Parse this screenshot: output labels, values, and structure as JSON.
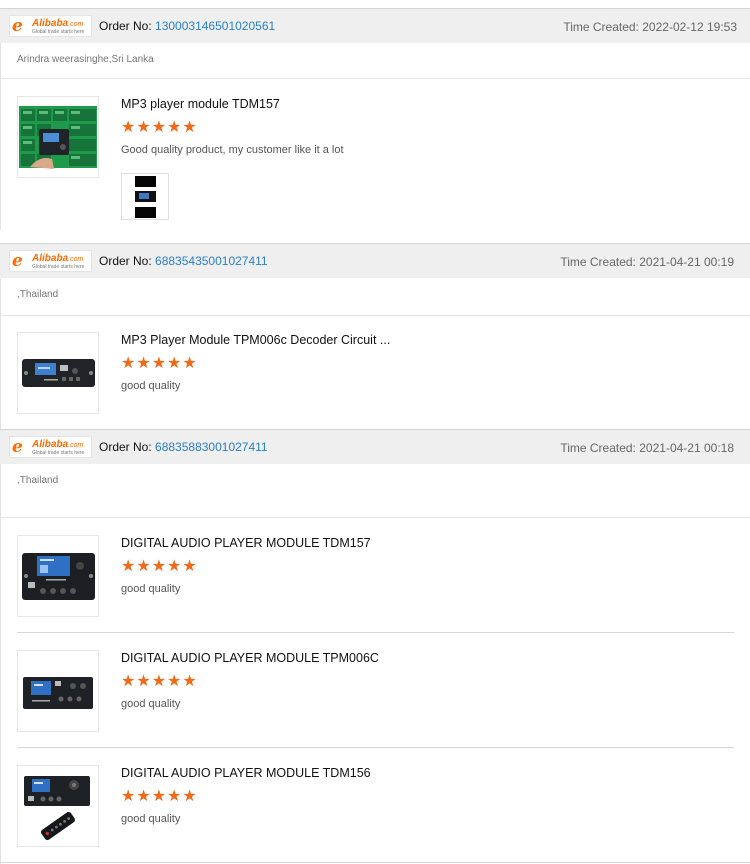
{
  "brand": {
    "logo_text": "Alibaba",
    "logo_suffix": ".com",
    "logo_tagline": "Global trade starts here"
  },
  "labels": {
    "order_no": "Order No:",
    "time_created": "Time Created:"
  },
  "colors": {
    "star": "#f06a1a",
    "order_number": "#2a7fc7",
    "header_bg": "#efefef",
    "brand": "#ff6a00"
  },
  "orders": [
    {
      "order_number": "130003146501020561",
      "time_created": "2022-02-12 19:53",
      "buyer": "Arindra weerasinghe,Sri Lanka",
      "items": [
        {
          "title": "MP3 player module TDM157",
          "rating": 5,
          "stars": "★★★★★",
          "review": "Good quality product, my customer like it a lot",
          "thumbnail_icon": "module-tray-photo",
          "has_review_photo": true
        }
      ]
    },
    {
      "order_number": "68835435001027411",
      "time_created": "2021-04-21 00:19",
      "buyer": ",Thailand",
      "items": [
        {
          "title": "MP3 Player Module TPM006c Decoder Circuit ...",
          "rating": 5,
          "stars": "★★★★★",
          "review": "good quality",
          "thumbnail_icon": "audio-module-photo"
        }
      ]
    },
    {
      "order_number": "68835883001027411",
      "time_created": "2021-04-21 00:18",
      "buyer": ",Thailand",
      "items": [
        {
          "title": "DIGITAL AUDIO PLAYER MODULE TDM157",
          "rating": 5,
          "stars": "★★★★★",
          "review": "good quality",
          "thumbnail_icon": "audio-module-photo"
        },
        {
          "title": "DIGITAL AUDIO PLAYER MODULE TPM006C",
          "rating": 5,
          "stars": "★★★★★",
          "review": "good quality",
          "thumbnail_icon": "audio-module-photo"
        },
        {
          "title": "DIGITAL AUDIO PLAYER MODULE TDM156",
          "rating": 5,
          "stars": "★★★★★",
          "review": "good quality",
          "thumbnail_icon": "audio-module-with-remote-photo"
        }
      ]
    }
  ]
}
